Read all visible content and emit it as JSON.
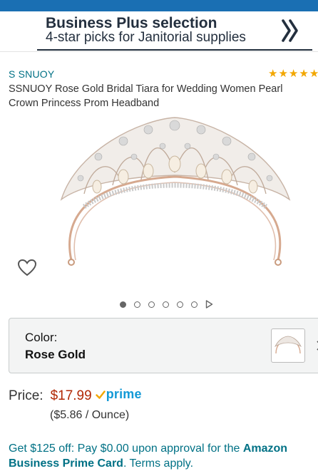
{
  "promo": {
    "title_prefix": "Business ",
    "title_bold": "Plus",
    "title_suffix": " selection",
    "subtitle": "4-star picks for Janitorial supplies",
    "arrow_icon": "double-chevron-right-icon"
  },
  "product": {
    "brand": "S SNUOY",
    "rating_stars": 5,
    "title": "SSNUOY Rose Gold Bridal Tiara for Wedding Women Pearl Crown Princess Prom Headband",
    "wishlist_icon": "heart-outline-icon"
  },
  "carousel": {
    "count": 6,
    "active_index": 0,
    "next_icon": "play-triangle-icon"
  },
  "variation": {
    "label": "Color:",
    "value": "Rose Gold"
  },
  "pricing": {
    "label": "Price:",
    "price": "$17.99",
    "prime": "prime",
    "unit_price": "($5.86 / Ounce)"
  },
  "offer": {
    "text_prefix": "Get $125 off: Pay $0.00 upon approval for the ",
    "text_bold": "Amazon Business Prime Card",
    "text_suffix": ". Terms apply."
  },
  "colors": {
    "topbar": "#1a6fb3",
    "link": "#007185",
    "price": "#b12704",
    "prime": "#1399d6",
    "star": "#f2a700"
  }
}
